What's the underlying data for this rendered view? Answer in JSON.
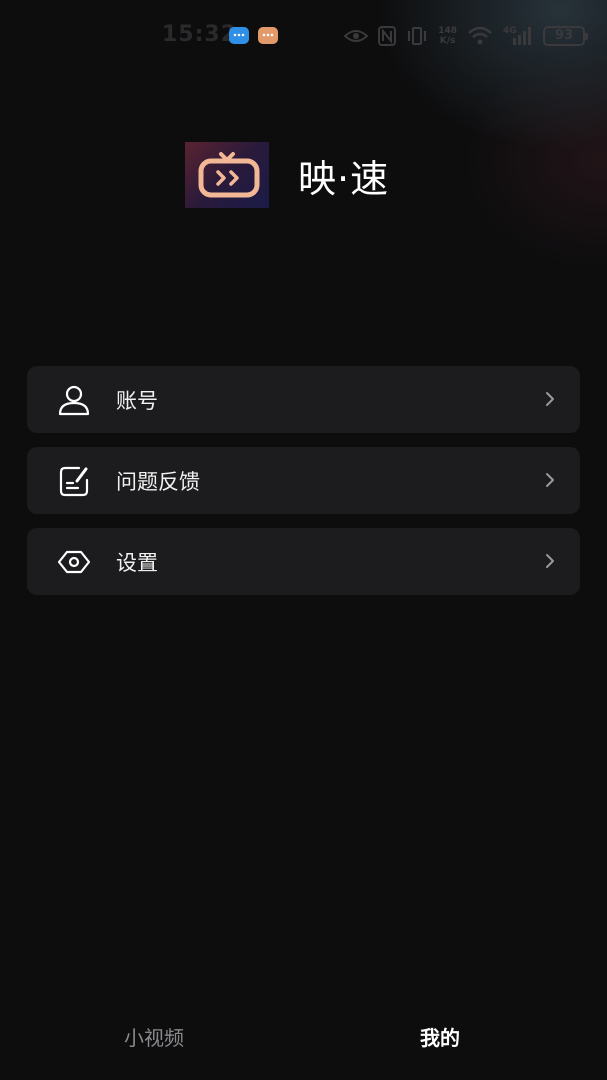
{
  "status_bar": {
    "time": "15:32",
    "network_speed_top": "148",
    "network_speed_bottom": "K/s",
    "signal_label": "4G",
    "battery": "93"
  },
  "header": {
    "app_name": "映·速",
    "logo_icon": "tv-play-icon"
  },
  "menu": {
    "items": [
      {
        "label": "账号",
        "icon": "user-icon"
      },
      {
        "label": "问题反馈",
        "icon": "feedback-edit-icon"
      },
      {
        "label": "设置",
        "icon": "settings-eye-icon"
      }
    ]
  },
  "bottom_nav": {
    "tabs": [
      {
        "label": "小视频",
        "active": false
      },
      {
        "label": "我的",
        "active": true
      }
    ]
  },
  "colors": {
    "background": "#0d0d0e",
    "card": "#1c1c1e",
    "text_primary": "#ffffff",
    "text_inactive": "#8a8a8e",
    "logo_accent": "#f2b896"
  }
}
